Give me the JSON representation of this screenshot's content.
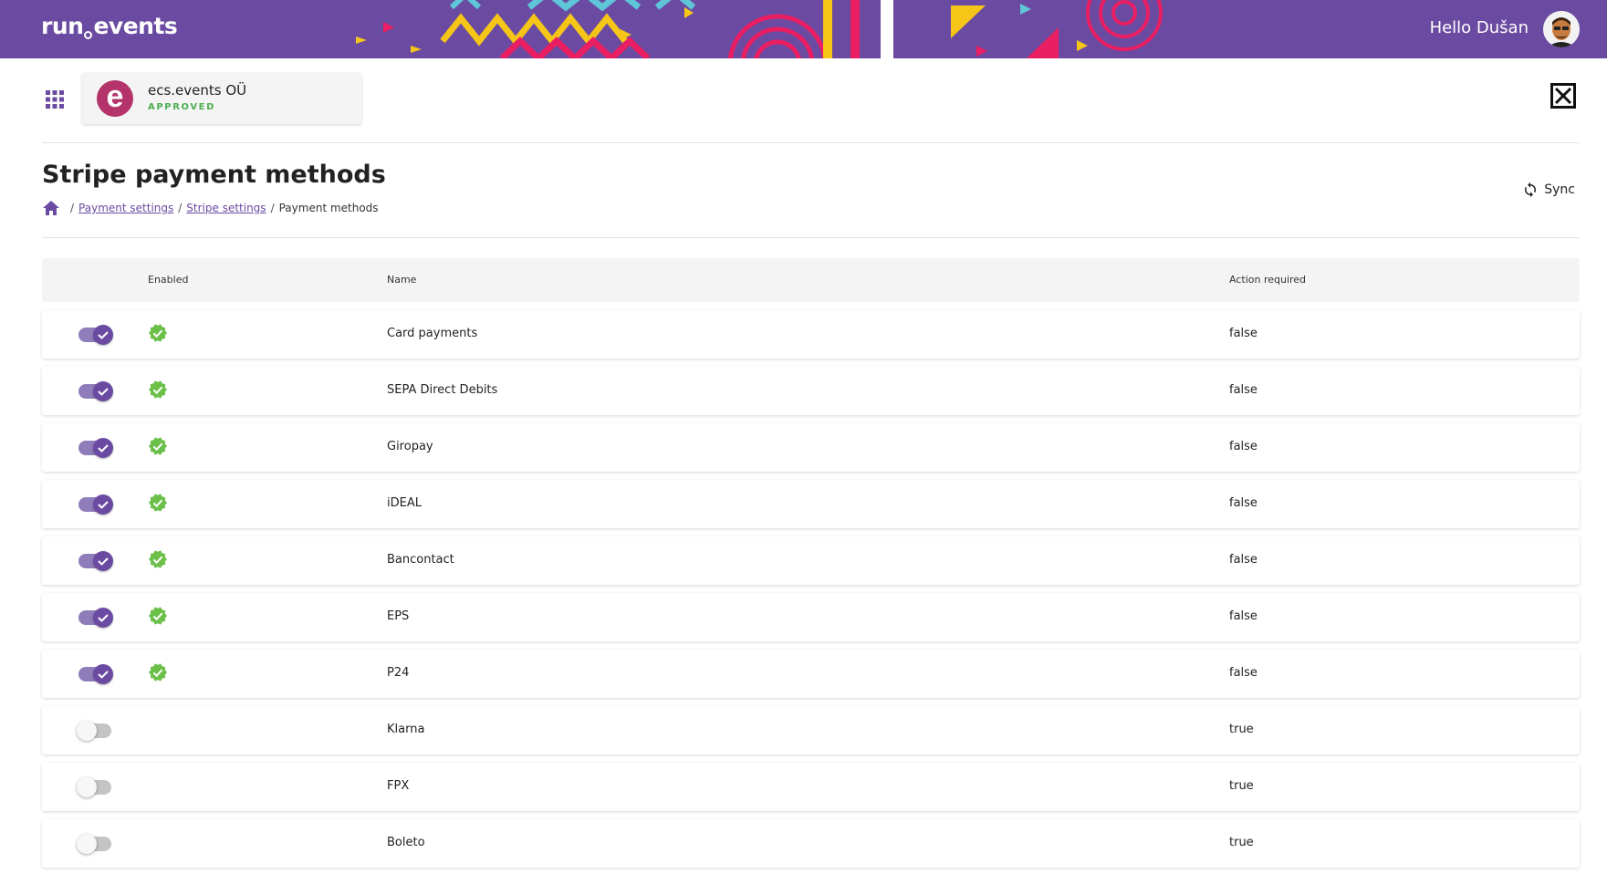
{
  "header": {
    "logo_left": "run",
    "logo_right": "events",
    "greeting": "Hello Dušan"
  },
  "org": {
    "logo_letter": "e",
    "name": "ecs.events OÜ",
    "status": "APPROVED"
  },
  "page": {
    "title": "Stripe payment methods",
    "sync_label": "Sync",
    "breadcrumb": {
      "link1": "Payment settings",
      "link2": "Stripe settings",
      "current": "Payment methods"
    }
  },
  "table": {
    "headers": {
      "enabled": "Enabled",
      "name": "Name",
      "action": "Action required"
    },
    "rows": [
      {
        "name": "Card payments",
        "action": "false",
        "enabled": true
      },
      {
        "name": "SEPA Direct Debits",
        "action": "false",
        "enabled": true
      },
      {
        "name": "Giropay",
        "action": "false",
        "enabled": true
      },
      {
        "name": "iDEAL",
        "action": "false",
        "enabled": true
      },
      {
        "name": "Bancontact",
        "action": "false",
        "enabled": true
      },
      {
        "name": "EPS",
        "action": "false",
        "enabled": true
      },
      {
        "name": "P24",
        "action": "false",
        "enabled": true
      },
      {
        "name": "Klarna",
        "action": "true",
        "enabled": false
      },
      {
        "name": "FPX",
        "action": "true",
        "enabled": false
      },
      {
        "name": "Boleto",
        "action": "true",
        "enabled": false
      }
    ]
  },
  "colors": {
    "brand": "#6b4ba1",
    "success": "#4caf50",
    "org_logo": "#b3336a"
  },
  "icons": {
    "apps": "apps-grid-icon",
    "close": "close-box-icon",
    "home": "home-icon",
    "sync": "sync-icon",
    "enabled": "verified-check-icon"
  }
}
